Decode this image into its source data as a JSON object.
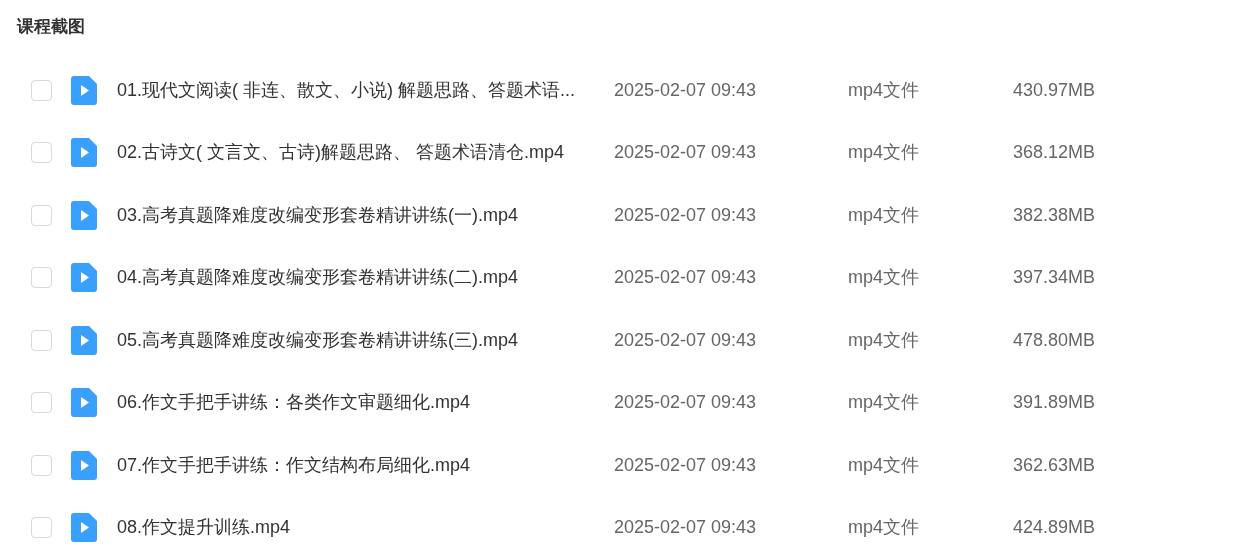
{
  "title": "课程截图",
  "files": [
    {
      "checked": false,
      "name": "01.现代文阅读( 非连、散文、小说) 解题思路、答题术语...",
      "date": "2025-02-07 09:43",
      "type": "mp4文件",
      "size": "430.97MB"
    },
    {
      "checked": false,
      "name": "02.古诗文( 文言文、古诗)解题思路、 答题术语清仓.mp4",
      "date": "2025-02-07 09:43",
      "type": "mp4文件",
      "size": "368.12MB"
    },
    {
      "checked": false,
      "name": "03.高考真题降难度改编变形套卷精讲讲练(一).mp4",
      "date": "2025-02-07 09:43",
      "type": "mp4文件",
      "size": "382.38MB"
    },
    {
      "checked": false,
      "name": "04.高考真题降难度改编变形套卷精讲讲练(二).mp4",
      "date": "2025-02-07 09:43",
      "type": "mp4文件",
      "size": "397.34MB"
    },
    {
      "checked": false,
      "name": "05.高考真题降难度改编变形套卷精讲讲练(三).mp4",
      "date": "2025-02-07 09:43",
      "type": "mp4文件",
      "size": "478.80MB"
    },
    {
      "checked": false,
      "name": "06.作文手把手讲练：各类作文审题细化.mp4",
      "date": "2025-02-07 09:43",
      "type": "mp4文件",
      "size": "391.89MB"
    },
    {
      "checked": false,
      "name": "07.作文手把手讲练：作文结构布局细化.mp4",
      "date": "2025-02-07 09:43",
      "type": "mp4文件",
      "size": "362.63MB"
    },
    {
      "checked": false,
      "name": "08.作文提升训练.mp4",
      "date": "2025-02-07 09:43",
      "type": "mp4文件",
      "size": "424.89MB"
    }
  ]
}
